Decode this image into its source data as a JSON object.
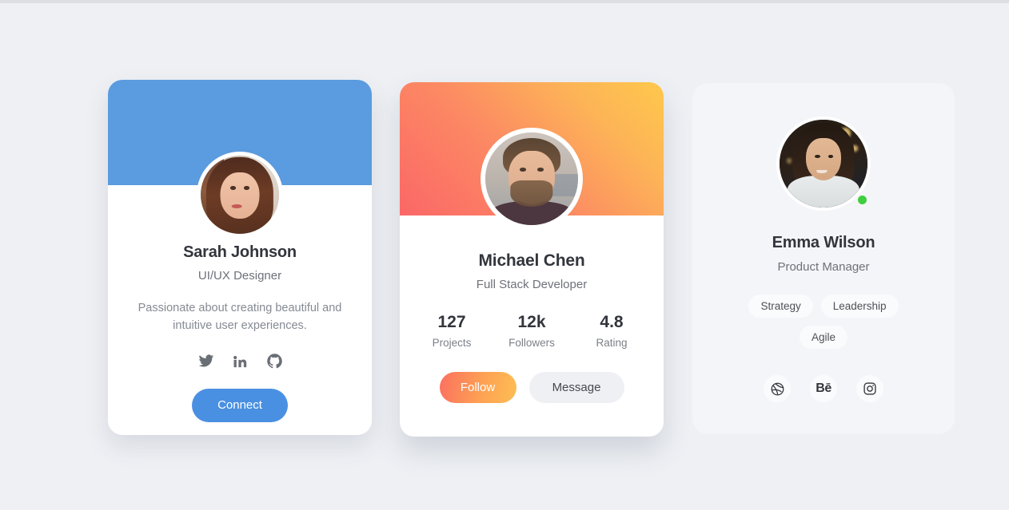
{
  "page": {
    "background_color": "#eef0f4"
  },
  "cards": [
    {
      "id": "sarah",
      "name": "Sarah Johnson",
      "role": "UI/UX Designer",
      "bio": "Passionate about creating beautiful and intuitive user experiences.",
      "banner_color": "#5b9bdf",
      "avatar_alt": "Sarah Johnson profile photo",
      "socials": [
        {
          "icon": "twitter-icon",
          "label": "Twitter"
        },
        {
          "icon": "linkedin-icon",
          "label": "LinkedIn"
        },
        {
          "icon": "github-icon",
          "label": "GitHub"
        }
      ],
      "cta": {
        "label": "Connect",
        "color": "#4a90e2"
      }
    },
    {
      "id": "michael",
      "name": "Michael Chen",
      "role": "Full Stack Developer",
      "avatar_alt": "Michael Chen profile photo",
      "banner_gradient_from": "#fb6767",
      "banner_gradient_to": "#fec84b",
      "stats": [
        {
          "value": "127",
          "label": "Projects"
        },
        {
          "value": "12k",
          "label": "Followers"
        },
        {
          "value": "4.8",
          "label": "Rating"
        }
      ],
      "actions": [
        {
          "label": "Follow",
          "style": "gradient"
        },
        {
          "label": "Message",
          "style": "muted"
        }
      ]
    },
    {
      "id": "emma",
      "name": "Emma Wilson",
      "role": "Product Manager",
      "avatar_alt": "Emma Wilson profile photo",
      "card_color": "#f4f5f8",
      "status": {
        "state": "online",
        "color": "#3fce3f"
      },
      "tags": [
        "Strategy",
        "Leadership",
        "Agile"
      ],
      "socials": [
        {
          "icon": "dribbble-icon",
          "label": "Dribbble"
        },
        {
          "icon": "behance-icon",
          "label": "Behance",
          "mark": "Bē"
        },
        {
          "icon": "instagram-icon",
          "label": "Instagram"
        }
      ]
    }
  ]
}
